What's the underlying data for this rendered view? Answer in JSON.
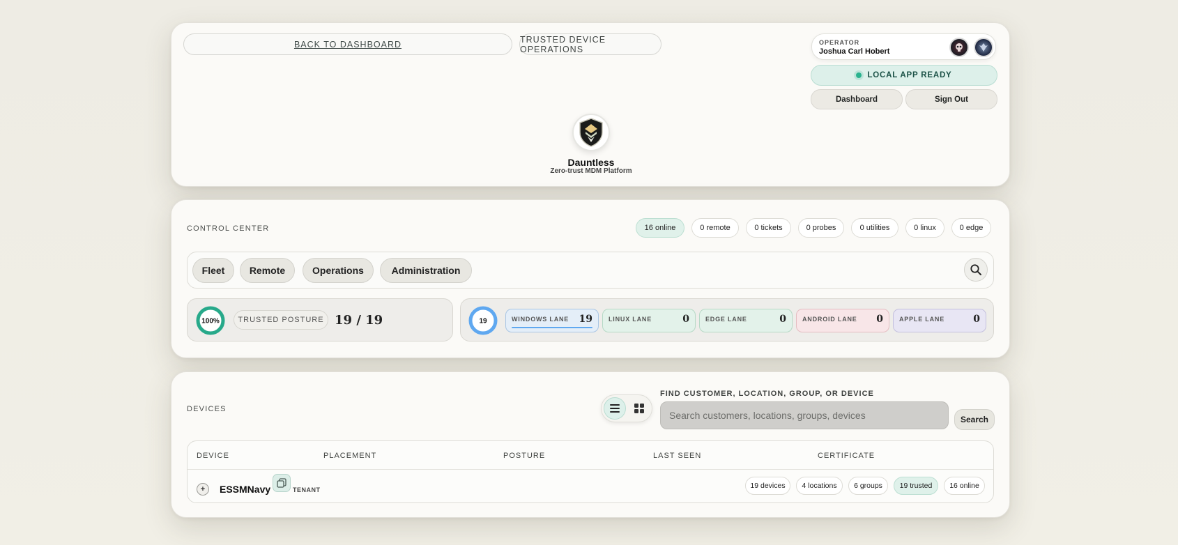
{
  "header": {
    "back_link": "BACK TO DASHBOARD",
    "trusted_ops": "TRUSTED DEVICE OPERATIONS",
    "operator_label": "OPERATOR",
    "operator_name": "Joshua Carl Hobert",
    "status": "LOCAL APP READY",
    "dashboard_button": "Dashboard",
    "signout_button": "Sign Out",
    "brand_name": "Dauntless",
    "brand_tagline": "Zero-trust MDM Platform"
  },
  "control_center": {
    "label": "CONTROL CENTER",
    "stats": [
      "16 online",
      "0 remote",
      "0 tickets",
      "0 probes",
      "0 utilities",
      "0 linux",
      "0 edge"
    ],
    "tabs": [
      "Fleet",
      "Remote",
      "Operations",
      "Administration"
    ],
    "posture_percent": "100%",
    "posture_fraction": 1.0,
    "posture_label": "TRUSTED POSTURE",
    "posture_count": "19 / 19",
    "lanes_total": "19",
    "lanes": [
      {
        "label": "WINDOWS LANE",
        "value": "19"
      },
      {
        "label": "LINUX LANE",
        "value": "0"
      },
      {
        "label": "EDGE LANE",
        "value": "0"
      },
      {
        "label": "ANDROID LANE",
        "value": "0"
      },
      {
        "label": "APPLE LANE",
        "value": "0"
      }
    ]
  },
  "devices": {
    "label": "DEVICES",
    "find_label": "FIND CUSTOMER, LOCATION, GROUP, OR DEVICE",
    "search_placeholder": "Search customers, locations, groups, devices",
    "search_button": "Search",
    "columns": [
      "DEVICE",
      "PLACEMENT",
      "POSTURE",
      "LAST SEEN",
      "CERTIFICATE"
    ],
    "row": {
      "expand": "+",
      "name": "ESSMNavy",
      "tag": "TENANT",
      "pills": [
        "19 devices",
        "4 locations",
        "6 groups",
        "19 trusted",
        "16 online"
      ]
    }
  },
  "colors": {
    "accent_green": "#2ab38f",
    "accent_blue": "#5fa8f0",
    "windows_lane": "#e4eef8",
    "linux_lane": "#e3f2ea",
    "edge_lane": "#e3f2ea",
    "android_lane": "#f8e6e8",
    "apple_lane": "#e8e6f4"
  },
  "icons": {
    "logo": "shield-logo-icon",
    "search": "search-icon",
    "list_view": "list-icon",
    "grid_view": "grid-icon",
    "tenant": "tenant-copy-icon"
  }
}
